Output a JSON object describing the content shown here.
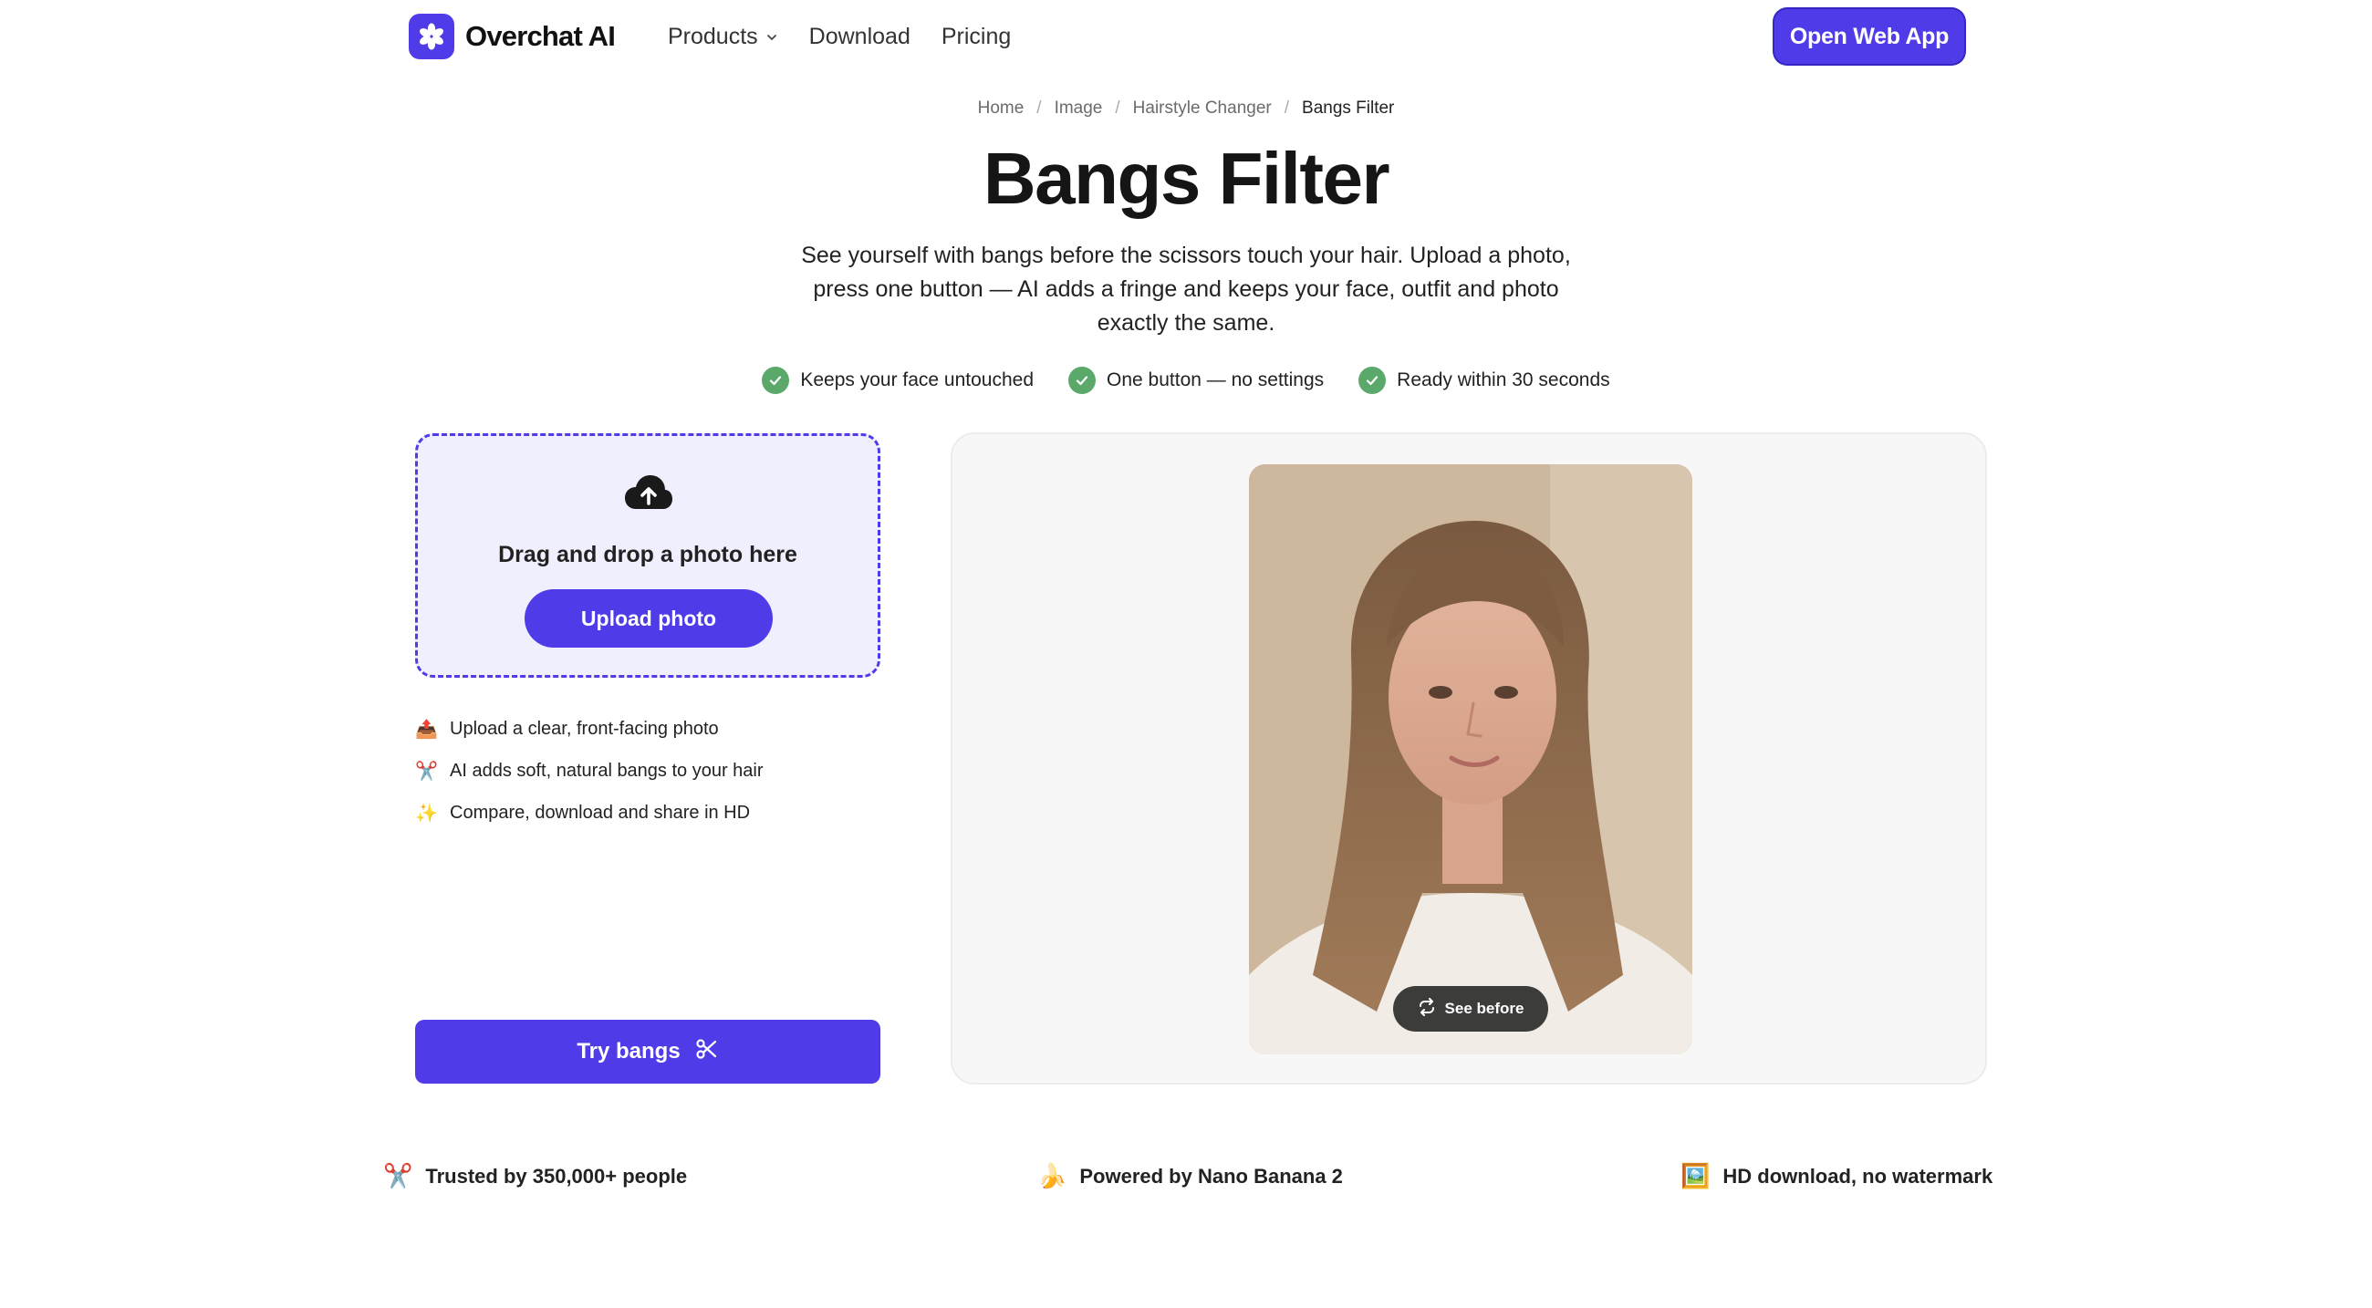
{
  "header": {
    "brand": "Overchat AI",
    "nav": [
      {
        "label": "Products",
        "has_dropdown": true
      },
      {
        "label": "Download",
        "has_dropdown": false
      },
      {
        "label": "Pricing",
        "has_dropdown": false
      }
    ],
    "cta_label": "Open Web App"
  },
  "breadcrumb": [
    "Home",
    "Image",
    "Hairstyle Changer",
    "Bangs Filter"
  ],
  "hero": {
    "title": "Bangs Filter",
    "subtitle": "See yourself with bangs before the scissors touch your hair. Upload a photo, press one button — AI adds a fringe and keeps your face, outfit and photo exactly the same.",
    "checks": [
      "Keeps your face untouched",
      "One button — no settings",
      "Ready within 30 seconds"
    ]
  },
  "upload": {
    "drop_text": "Drag and drop a photo here",
    "button_label": "Upload photo",
    "tips": [
      {
        "icon": "📤",
        "text": "Upload a clear, front-facing photo"
      },
      {
        "icon": "✂️",
        "text": "AI adds soft, natural bangs to your hair"
      },
      {
        "icon": "✨",
        "text": "Compare, download and share in HD"
      }
    ],
    "try_label": "Try bangs"
  },
  "preview": {
    "toggle_label": "See before"
  },
  "stats": [
    {
      "icon": "✂️",
      "text": "Trusted by 350,000+ people"
    },
    {
      "icon": "🍌",
      "text": "Powered by Nano Banana 2"
    },
    {
      "icon": "🖼️",
      "text": "HD download, no watermark"
    }
  ],
  "colors": {
    "accent": "#4f3ce8",
    "check_green": "#5aa96a",
    "dropzone_bg": "#f0effd"
  }
}
